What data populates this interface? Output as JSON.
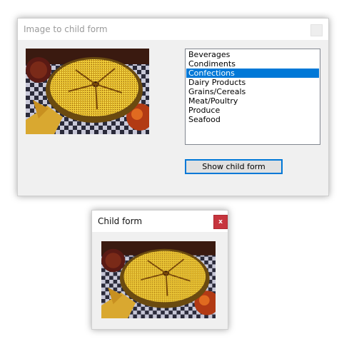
{
  "main_window": {
    "title": "Image to child form",
    "image_icon": "pie-photo-icon",
    "category_list": {
      "items": [
        "Beverages",
        "Condiments",
        "Confections",
        "Dairy Products",
        "Grains/Cereals",
        "Meat/Poultry",
        "Produce",
        "Seafood"
      ],
      "selected": "Confections"
    },
    "show_child_button": "Show child form"
  },
  "child_window": {
    "title": "Child form",
    "close_label": "x",
    "image_icon": "pie-photo-icon"
  },
  "colors": {
    "selection": "#0078d7",
    "close_red": "#c7353e",
    "window_bg": "#f0f0f0"
  }
}
